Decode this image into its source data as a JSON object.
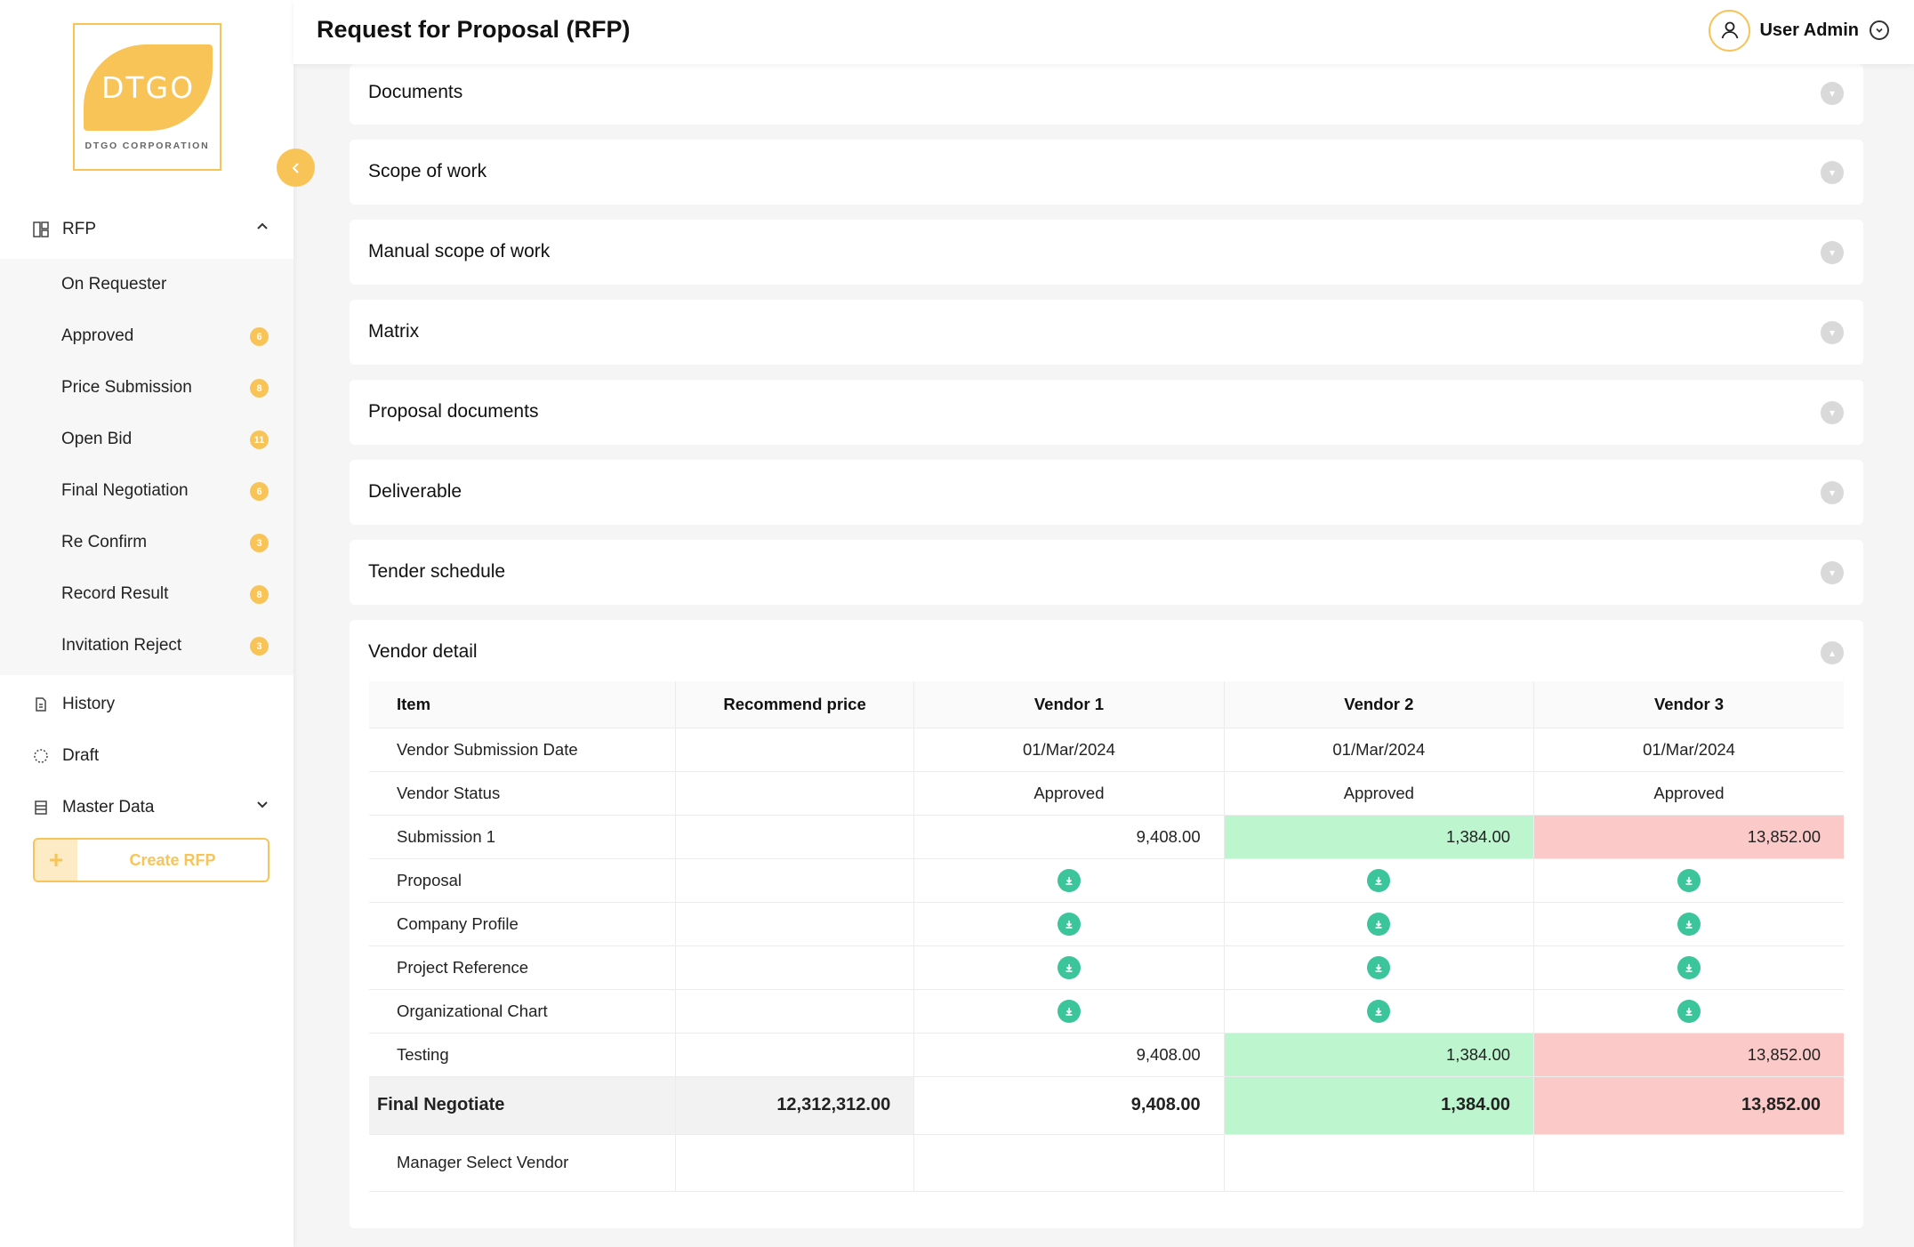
{
  "logo": {
    "brand": "DTGO",
    "subtitle": "DTGO CORPORATION"
  },
  "header": {
    "title": "Request for Proposal (RFP)",
    "user_name": "User Admin"
  },
  "sidebar": {
    "rfp_label": "RFP",
    "submenu": [
      {
        "label": "On Requester",
        "badge": ""
      },
      {
        "label": "Approved",
        "badge": "6"
      },
      {
        "label": "Price Submission",
        "badge": "8"
      },
      {
        "label": "Open Bid",
        "badge": "11"
      },
      {
        "label": "Final Negotiation",
        "badge": "6"
      },
      {
        "label": "Re Confirm",
        "badge": "3"
      },
      {
        "label": "Record Result",
        "badge": "8"
      },
      {
        "label": "Invitation Reject",
        "badge": "3"
      }
    ],
    "history_label": "History",
    "draft_label": "Draft",
    "master_label": "Master Data",
    "create_label": "Create RFP"
  },
  "sections": [
    "Documents",
    "Scope of work",
    "Manual scope of work",
    "Matrix",
    "Proposal documents",
    "Deliverable",
    "Tender schedule",
    "Vendor detail"
  ],
  "vendor_table": {
    "headers": [
      "Item",
      "Recommend price",
      "Vendor 1",
      "Vendor 2",
      "Vendor 3"
    ],
    "rows": {
      "submission_date": {
        "label": "Vendor Submission Date",
        "v1": "01/Mar/2024",
        "v2": "01/Mar/2024",
        "v3": "01/Mar/2024"
      },
      "status": {
        "label": "Vendor Status",
        "v1": "Approved",
        "v2": "Approved",
        "v3": "Approved"
      },
      "submission1": {
        "label": "Submission 1",
        "v1": "9,408.00",
        "v2": "1,384.00",
        "v3": "13,852.00"
      },
      "proposal": {
        "label": "Proposal"
      },
      "company_profile": {
        "label": "Company Profile"
      },
      "project_reference": {
        "label": "Project Reference"
      },
      "org_chart": {
        "label": "Organizational Chart"
      },
      "testing": {
        "label": "Testing",
        "v1": "9,408.00",
        "v2": "1,384.00",
        "v3": "13,852.00"
      },
      "final": {
        "label": "Final Negotiate",
        "rec": "12,312,312.00",
        "v1": "9,408.00",
        "v2": "1,384.00",
        "v3": "13,852.00"
      },
      "manager": {
        "label": "Manager Select Vendor"
      }
    }
  },
  "colors": {
    "accent": "#f8c458",
    "lowest": "#bdf5cf",
    "highest": "#fcc9c9",
    "download": "#3cc49a"
  }
}
